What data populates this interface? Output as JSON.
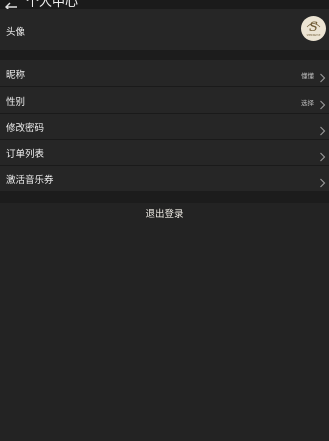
{
  "header": {
    "title": "个人中心"
  },
  "profile": {
    "avatar_label": "头像",
    "avatar_logo_letter": "S",
    "avatar_logo_caption": "SHIMINGYUE"
  },
  "settings": {
    "items": [
      {
        "label": "昵称",
        "value": "懂懂"
      },
      {
        "label": "性别",
        "value": "选择"
      },
      {
        "label": "修改密码",
        "value": ""
      },
      {
        "label": "订单列表",
        "value": ""
      },
      {
        "label": "激活音乐券",
        "value": ""
      }
    ]
  },
  "actions": {
    "logout_label": "退出登录"
  },
  "colors": {
    "background": "#232323",
    "row_background": "#262626",
    "gap_background": "#1c1c1c",
    "avatar_background": "#ece4d3",
    "logo_ink": "#6e5a34"
  },
  "icons": {
    "back": "back-arrow-icon",
    "chevron": "chevron-right-icon",
    "avatar_logo": "brand-logo-icon"
  }
}
